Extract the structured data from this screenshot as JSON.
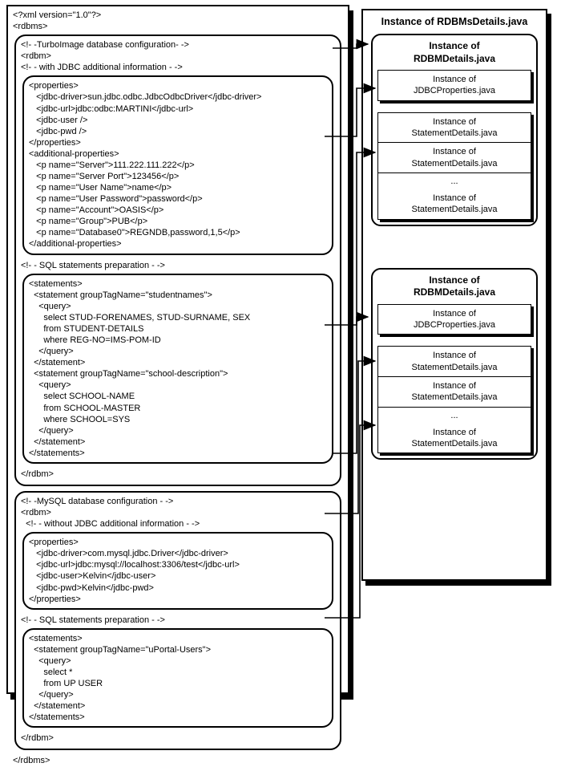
{
  "right": {
    "title": "Instance of RDBMsDetails.java",
    "instances": [
      {
        "title1": "Instance of",
        "title2": "RDBMDetails.java",
        "jdbc1": "Instance of",
        "jdbc2": "JDBCProperties.java",
        "stmt1": "Instance of",
        "stmt2": "StatementDetails.java",
        "dots": "..."
      },
      {
        "title1": "Instance of",
        "title2": "RDBMDetails.java",
        "jdbc1": "Instance of",
        "jdbc2": "JDBCProperties.java",
        "stmt1": "Instance of",
        "stmt2": "StatementDetails.java",
        "dots": "..."
      }
    ]
  },
  "left": {
    "xml_header": "<?xml version=\"1.0\"?>",
    "rdbms_open": "<rdbms>",
    "rdbms_close": "</rdbms>",
    "rdbm1": {
      "comment1": "<!- -TurboImage database configuration- ->",
      "open": "<rdbm>",
      "comment2": "<!- - with JDBC additional information - ->",
      "close": "</rdbm>",
      "props": {
        "open": "<properties>",
        "l1": "   <jdbc-driver>sun.jdbc.odbc.JdbcOdbcDriver</jdbc-driver>",
        "l2": "   <jdbc-url>jdbc:odbc:MARTINI</jdbc-url>",
        "l3": "   <jdbc-user />",
        "l4": "   <jdbc-pwd />",
        "close": "</properties>",
        "addopen": "<additional-properties>",
        "a1": "   <p name=\"Server\">111.222.111.222</p>",
        "a2": "   <p name=\"Server Port\">123456</p>",
        "a3": "   <p name=\"User Name\">name</p>",
        "a4": "   <p name=\"User Password\">password</p>",
        "a5": "   <p name=\"Account\">OASIS</p>",
        "a6": "   <p name=\"Group\">PUB</p>",
        "a7": "   <p name=\"Database0\">REGNDB,password,1,5</p>",
        "addclose": "</additional-properties>"
      },
      "sqlcomment": "<!- - SQL statements preparation - ->",
      "stmts": {
        "open": "<statements>",
        "s1open": "  <statement groupTagName=\"studentnames\">",
        "q1open": "    <query>",
        "q1l1": "      select STUD-FORENAMES, STUD-SURNAME, SEX",
        "q1l2": "      from STUDENT-DETAILS",
        "q1l3": "      where REG-NO=IMS-POM-ID",
        "q1close": "    </query>",
        "s1close": "  </statement>",
        "s2open": "  <statement groupTagName=\"school-description\">",
        "q2open": "    <query>",
        "q2l1": "      select SCHOOL-NAME",
        "q2l2": "      from SCHOOL-MASTER",
        "q2l3": "      where SCHOOL=SYS",
        "q2close": "    </query>",
        "s2close": "  </statement>",
        "close": "</statements>"
      }
    },
    "rdbm2": {
      "comment1": "<!- -MySQL database configuration - ->",
      "open": "<rdbm>",
      "comment2": "  <!- - without JDBC additional information - ->",
      "close": "</rdbm>",
      "props": {
        "open": "<properties>",
        "l1": "   <jdbc-driver>com.mysql.jdbc.Driver</jdbc-driver>",
        "l2": "   <jdbc-url>jdbc:mysql://localhost:3306/test</jdbc-url>",
        "l3": "   <jdbc-user>Kelvin</jdbc-user>",
        "l4": "   <jdbc-pwd>Kelvin</jdbc-pwd>",
        "close": "</properties>"
      },
      "sqlcomment": "<!- - SQL statements preparation - ->",
      "stmts": {
        "open": "<statements>",
        "s1open": "  <statement groupTagName=\"uPortal-Users\">",
        "q1open": "    <query>",
        "q1l1": "      select *",
        "q1l2": "      from UP USER",
        "q1close": "    </query>",
        "s1close": "  </statement>",
        "close": "</statements>"
      }
    }
  }
}
